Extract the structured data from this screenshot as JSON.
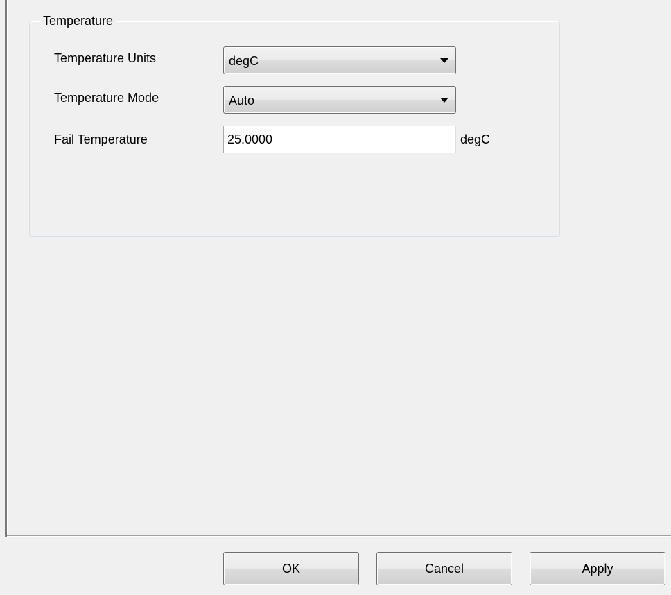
{
  "group": {
    "title": "Temperature"
  },
  "fields": {
    "units": {
      "label": "Temperature Units",
      "value": "degC"
    },
    "mode": {
      "label": "Temperature Mode",
      "value": "Auto"
    },
    "fail": {
      "label": "Fail Temperature",
      "value": "25.0000",
      "unit": "degC"
    }
  },
  "buttons": {
    "ok": "OK",
    "cancel": "Cancel",
    "apply": "Apply"
  },
  "icons": {
    "dropdown": "chevron-down-icon"
  }
}
